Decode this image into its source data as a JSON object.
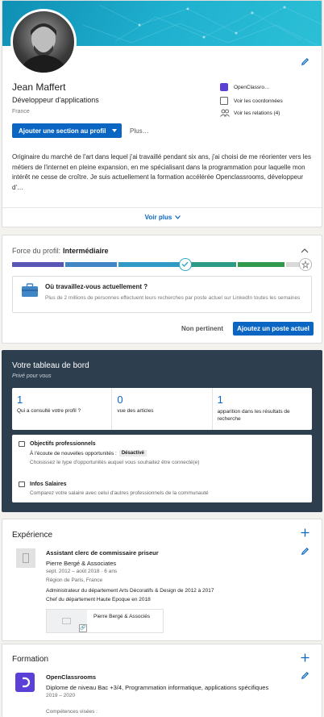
{
  "profile": {
    "name": "Jean Maffert",
    "headline": "Développeur d'applications",
    "location": "France",
    "add_section_label": "Ajouter une section au profil",
    "more_label": "Plus…",
    "side_links": [
      "OpenClassro…",
      "Voir les coordonnées",
      "Voir les relations (4)"
    ],
    "about": "Originaire du marché de l'art dans lequel j'ai travaillé pendant six ans, j'ai choisi de me réorienter vers les métiers de l'internet en pleine expansion, en me spécialisant dans la programmation pour laquelle mon intérêt ne cesse de croître. Je suis actuellement la formation accélérée Openclassrooms, développeur d'…",
    "see_more": "Voir plus"
  },
  "strength": {
    "label": "Force du profil:",
    "level": "Intermédiaire",
    "progress_fraction": 0.57,
    "prompt_title": "Où travaillez-vous actuellement ?",
    "prompt_body": "Plus de 2 millions de personnes effectuent leurs recherches par poste actuel sur LinkedIn toutes les semaines",
    "dismiss_label": "Non pertinent",
    "add_label": "Ajoutez un poste actuel"
  },
  "dashboard": {
    "title": "Votre tableau de bord",
    "subtitle": "Privé pour vous",
    "stats": [
      {
        "value": "1",
        "label": "Qui a consulté votre profil ?"
      },
      {
        "value": "0",
        "label": "vue des articles"
      },
      {
        "value": "1",
        "label": "apparition dans les résultats de recherche"
      }
    ],
    "goals_title": "Objectifs professionnels",
    "goals_status": "À l'écoute de nouvelles opportunités :",
    "goals_badge": "Désactivé",
    "goals_desc": "Choisissez le type d'opportunités auquel vous souhaitez être connecté(e)",
    "salary_title": "Infos Salaires",
    "salary_desc": "Comparez votre salaire avec celui d'autres professionnels de la communauté"
  },
  "experience": {
    "title": "Expérience",
    "role": "Assistant clerc de commissaire priseur",
    "company": "Pierre Bergé & Associates",
    "dates": "sept. 2012 – août 2018 · 6 ans",
    "location": "Région de Paris, France",
    "desc1": "Administrateur du département Arts Décoratifs & Design de 2012 à 2017",
    "desc2": "Chef du département Haute Epoque en 2018",
    "media_label": "Pierre Bergé & Associés"
  },
  "education": {
    "title": "Formation",
    "school": "OpenClassrooms",
    "degree": "Diplome de niveau Bac +3/4, Programmation informatique, applications spécifiques",
    "years": "2019 – 2020",
    "skills_label": "Compétences visées :"
  },
  "colors": {
    "accent": "#0a66c2",
    "banner": "#1ea3c4",
    "dashboard_bg": "#2d3e4e",
    "purple": "#5b3fd6"
  }
}
